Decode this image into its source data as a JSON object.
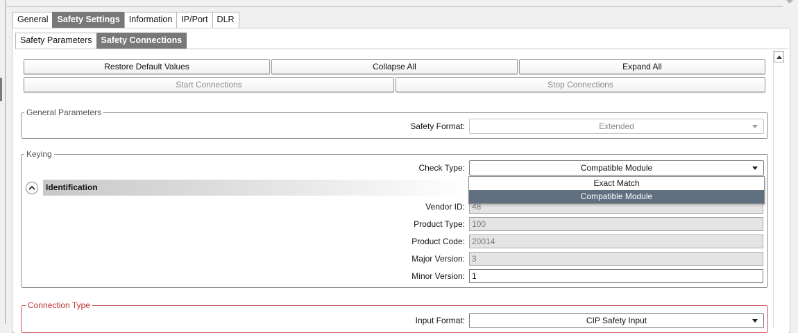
{
  "tabs": {
    "main": [
      {
        "label": "General",
        "active": false
      },
      {
        "label": "Safety Settings",
        "active": true
      },
      {
        "label": "Information",
        "active": false
      },
      {
        "label": "IP/Port",
        "active": false
      },
      {
        "label": "DLR",
        "active": false
      }
    ],
    "sub": [
      {
        "label": "Safety Parameters",
        "active": false
      },
      {
        "label": "Safety Connections",
        "active": true
      }
    ]
  },
  "toolbar": {
    "restore_label": "Restore Default Values",
    "collapse_label": "Collapse All",
    "expand_label": "Expand All",
    "start_label": "Start Connections",
    "stop_label": "Stop Connections"
  },
  "general_parameters": {
    "legend": "General Parameters",
    "safety_format_label": "Safety Format:",
    "safety_format_value": "Extended"
  },
  "keying": {
    "legend": "Keying",
    "check_type_label": "Check Type:",
    "check_type_value": "Compatible Module",
    "check_type_options": [
      "Exact Match",
      "Compatible Module"
    ],
    "identification_title": "Identification",
    "vendor_id_label": "Vendor ID:",
    "vendor_id_value": "48",
    "product_type_label": "Product Type:",
    "product_type_value": "100",
    "product_code_label": "Product Code:",
    "product_code_value": "20014",
    "major_version_label": "Major Version:",
    "major_version_value": "3",
    "minor_version_label": "Minor Version:",
    "minor_version_value": "1"
  },
  "connection_type": {
    "legend": "Connection Type",
    "input_format_label": "Input Format:",
    "input_format_value": "CIP Safety Input"
  },
  "colors": {
    "active_tab": "#787878",
    "selected_option": "#607080",
    "connection_border": "#c95050"
  }
}
